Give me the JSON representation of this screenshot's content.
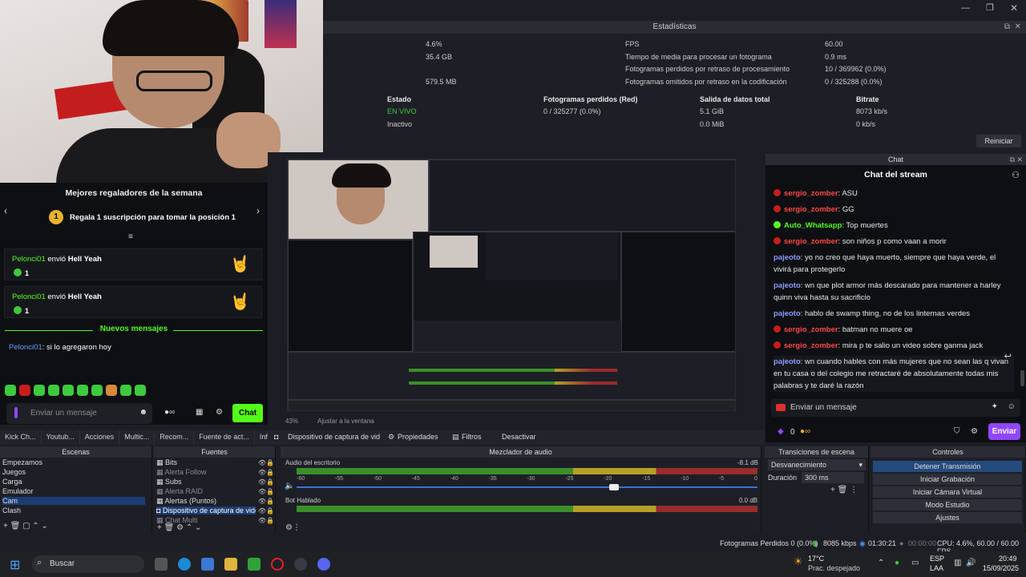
{
  "stats": {
    "title": "Estadísticas",
    "left_values": [
      "4.6%",
      "35.4 GB",
      "579.5 MB"
    ],
    "rows": [
      {
        "label": "FPS",
        "value": "60.00"
      },
      {
        "label": "Tiempo de media para procesar un fotograma",
        "value": "0.9 ms"
      },
      {
        "label": "Fotogramas perdidos por retraso de procesamiento",
        "value": "10 / 369962 (0.0%)"
      },
      {
        "label": "Fotogramas omitidos por retraso en la codificación",
        "value": "0 / 325288 (0.0%)"
      }
    ],
    "headers": [
      "Estado",
      "Fotogramas perdidos (Red)",
      "Salida de datos total",
      "Bitrate"
    ],
    "stream_row": [
      "EN VIVO",
      "0 / 325277 (0.0%)",
      "5.1 GiB",
      "8073 kb/s"
    ],
    "record_row": [
      "Inactivo",
      "0.0 MiB",
      "0 kb/s"
    ],
    "reset_label": "Reiniciar"
  },
  "gifters": {
    "title": "Mejores regaladores de la semana",
    "prompt": "Regala 1 suscripción para tomar la posición 1",
    "rank": "1",
    "cards": [
      {
        "user": "Pelonci01",
        "action": " envió ",
        "item": "Hell Yeah",
        "count": "1"
      },
      {
        "user": "Pelonci01",
        "action": " envió ",
        "item": "Hell Yeah",
        "count": "1"
      }
    ],
    "new_messages": "Nuevos mensajes",
    "message": {
      "user": "Pelonci01",
      "text": ": si lo agregaron hoy"
    },
    "input_placeholder": "Enviar un mensaje",
    "chat_button": "Chat"
  },
  "preview": {
    "zoom": "43%",
    "fit_label": "Ajustar a la ventana"
  },
  "dock_tabs": [
    "Kick Ch...",
    "Youtub...",
    "Acciones",
    "Multic...",
    "Recom...",
    "Fuente de act...",
    "Inform..."
  ],
  "source_bar": {
    "source": "Dispositivo de captura de vid",
    "properties": "Propiedades",
    "filters": "Filtros",
    "deactivate": "Desactivar"
  },
  "chat": {
    "dock_title": "Chat",
    "header": "Chat del stream",
    "messages": [
      {
        "user": "sergio_zomber",
        "color": "r",
        "text": ": ASU"
      },
      {
        "user": "sergio_zomber",
        "color": "r",
        "text": ": GG"
      },
      {
        "user": "Auto_Whatsapp",
        "color": "g",
        "text": ": Top muertes"
      },
      {
        "user": "sergio_zomber",
        "color": "r",
        "text": ": son niños p como vaan a morir"
      },
      {
        "user": "pajeoto",
        "color": "b",
        "text": ": yo no creo que haya muerto, siempre que haya verde, el vivirá para protegerlo"
      },
      {
        "user": "pajeoto",
        "color": "b",
        "text": ": wn que plot armor más descarado para mantener a harley quinn viva hasta su sacrificio"
      },
      {
        "user": "pajeoto",
        "color": "b",
        "text": ": hablo de swamp thing, no de los linternas verdes"
      },
      {
        "user": "sergio_zomber",
        "color": "r",
        "text": ": batman no muere oe"
      },
      {
        "user": "sergio_zomber",
        "color": "r",
        "text": ": mira p te salio un video sobre ganma jack"
      },
      {
        "user": "pajeoto",
        "color": "b",
        "text": ": wn cuando hables con más mujeres que no sean las q vivan en tu casa o del colegio me retractaré de absolutamente todas mis palabras y te daré la razón"
      }
    ],
    "input_placeholder": "Enviar un mensaje",
    "points": "0",
    "send_label": "Enviar"
  },
  "scenes": {
    "title": "Escenas",
    "items": [
      "Empezamos",
      "Juegos",
      "Carga",
      "Emulador",
      "Cam",
      "Clash"
    ],
    "selected": "Cam"
  },
  "sources": {
    "title": "Fuentes",
    "items": [
      "Bits",
      "Alerta Follow",
      "Subs",
      "Alerta RAID",
      "Alertas (Puntos)",
      "Dispositivo de captura de vide",
      "Chat Multi"
    ]
  },
  "mixer": {
    "title": "Mezclador de audio",
    "channels": [
      {
        "name": "Audio del escritorio",
        "db": "-8.1 dB"
      },
      {
        "name": "Bot Hablado",
        "db": "0.0 dB"
      }
    ],
    "scale": [
      "-60",
      "-55",
      "-50",
      "-45",
      "-40",
      "-35",
      "-30",
      "-25",
      "-20",
      "-15",
      "-10",
      "-5",
      "0"
    ]
  },
  "transitions": {
    "title": "Transiciones de escena",
    "type": "Desvanecimiento",
    "duration_label": "Duración",
    "duration": "300 ms"
  },
  "controls": {
    "title": "Controles",
    "buttons": [
      "Detener Transmisión",
      "Iniciar Grabación",
      "Iniciar Cámara Virtual",
      "Modo Estudio",
      "Ajustes"
    ]
  },
  "statusbar": {
    "dropped": "Fotogramas Perdidos 0 (0.0%)",
    "kbps": "8085 kbps",
    "live_time": "01:30:21",
    "rec_time": "00:00:00",
    "cpu": "CPU: 4.6%, 60.00 / 60.00 FPS"
  },
  "taskbar": {
    "search": "Buscar",
    "temp": "17°C",
    "weather": "Prac. despejado",
    "lang": "ESP",
    "lang2": "LAA",
    "time": "20:49",
    "date": "15/09/2025"
  }
}
